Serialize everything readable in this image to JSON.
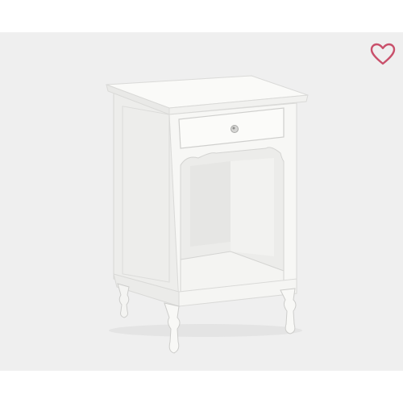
{
  "product": {
    "image_subject": "white-nightstand",
    "favorite": {
      "icon": "heart-outline-icon",
      "active": false,
      "color": "#c9506b"
    }
  },
  "colors": {
    "photo_background": "#efefef",
    "page_background": "#ffffff",
    "furniture_white": "#f7f7f5"
  }
}
